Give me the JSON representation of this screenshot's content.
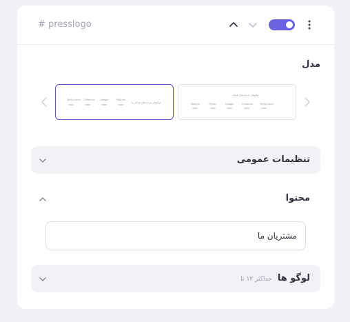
{
  "header": {
    "title": "# presslogo",
    "toggle_on": true,
    "accent_color": "#6b63e0"
  },
  "model": {
    "label": "مدل",
    "thumbnails": [
      {
        "caption": "لوگوهای شرکت‌های همکار",
        "selected": false,
        "logos": [
          "Podium",
          "Tinder",
          "Google",
          "Chronicle",
          "TechCrunch"
        ]
      },
      {
        "caption": "لوگوهای شرکت‌های همکار ما",
        "selected": true,
        "logos": [
          "TechCrunch",
          "Chronicle",
          "Google",
          "Podium"
        ]
      }
    ]
  },
  "sections": {
    "general": {
      "label": "تنظیمات عمومی"
    },
    "content": {
      "label": "محتوا"
    },
    "logos": {
      "label": "لوگو ها",
      "hint": "حداکثر ۱۲ تا"
    }
  },
  "content_field": {
    "value": "مشتریان ما"
  },
  "icons": {
    "collapse": "chevron-up-icon",
    "expand": "chevron-down-icon",
    "menu": "kebab-menu-icon",
    "prev": "chevron-left-icon",
    "next": "chevron-right-icon"
  }
}
